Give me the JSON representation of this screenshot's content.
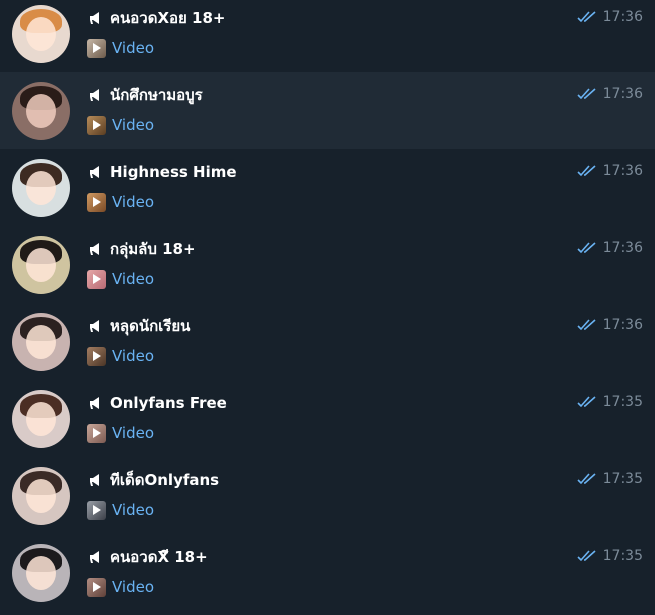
{
  "colors": {
    "background": "#17212b",
    "selected_row": "#202b36",
    "name": "#ffffff",
    "preview": "#6ab3f3",
    "time": "#7c8b99",
    "read_checks": "#6ab3f3"
  },
  "icons": {
    "channel": "megaphone-icon",
    "read": "double-check-icon",
    "media": "video-thumbnail-icon"
  },
  "chats": [
    {
      "name": "คนอวดXอย 18+",
      "preview": "Video",
      "time": "17:36",
      "selected": false
    },
    {
      "name": "นักศึกษามอบูร",
      "preview": "Video",
      "time": "17:36",
      "selected": true
    },
    {
      "name": "Highness Hime",
      "preview": "Video",
      "time": "17:36",
      "selected": false
    },
    {
      "name": "กลุ่มลับ 18+",
      "preview": "Video",
      "time": "17:36",
      "selected": false
    },
    {
      "name": "หลุดนักเรียน",
      "preview": "Video",
      "time": "17:36",
      "selected": false
    },
    {
      "name": "Onlyfans Free",
      "preview": "Video",
      "time": "17:35",
      "selected": false
    },
    {
      "name": "ทีเด็ดOnlyfans",
      "preview": "Video",
      "time": "17:35",
      "selected": false
    },
    {
      "name": "คนอวดXี 18+",
      "preview": "Video",
      "time": "17:35",
      "selected": false
    }
  ]
}
